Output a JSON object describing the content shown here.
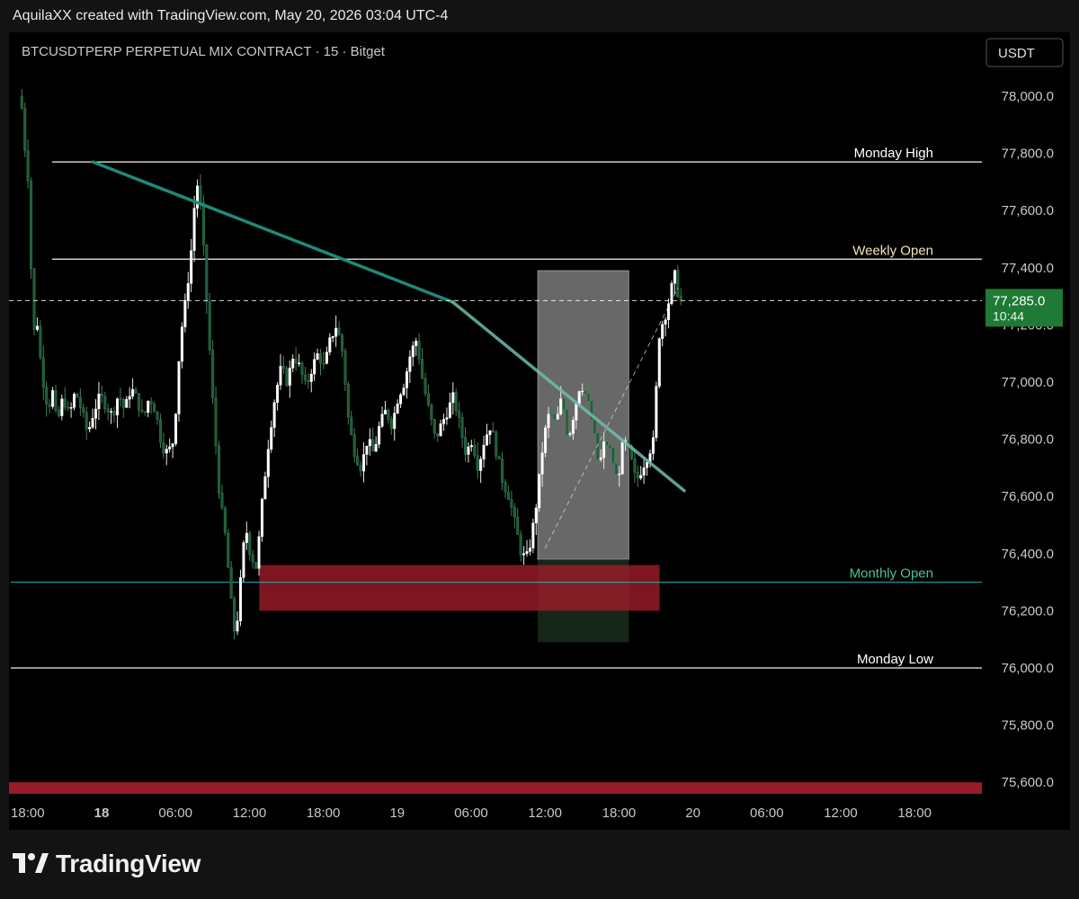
{
  "header": {
    "attribution": "AquilaXX created with TradingView.com, May 20, 2026 03:04 UTC-4"
  },
  "footer": {
    "brand": "TradingView"
  },
  "colors": {
    "background": "#000000",
    "candle_up": "#ffffff",
    "candle_down": "#1b5e3b",
    "trendline": "#1f8a78",
    "level_line": "#ffffff",
    "monthly_open_line": "#26a69a",
    "red_zone": "#9a1c2a",
    "current_price_bg": "#1e7a35"
  },
  "chart_data": {
    "type": "candlestick",
    "title": "BTCUSDTPERP PERPETUAL MIX CONTRACT · 15 · Bitget",
    "currency_button": "USDT",
    "ylim": [
      75600,
      78100
    ],
    "y_ticks": [
      "78,000.0",
      "77,800.0",
      "77,600.0",
      "77,400.0",
      "77,200.0",
      "77,000.0",
      "76,800.0",
      "76,600.0",
      "76,400.0",
      "76,200.0",
      "76,000.0",
      "75,800.0",
      "75,600.0"
    ],
    "x_ticks": [
      "18:00",
      "18",
      "06:00",
      "12:00",
      "18:00",
      "19",
      "06:00",
      "12:00",
      "18:00",
      "20",
      "06:00",
      "12:00",
      "18:00"
    ],
    "x_tick_hours": [
      -6,
      0,
      6,
      12,
      18,
      24,
      30,
      36,
      42,
      48,
      54,
      60,
      66
    ],
    "bold_ticks": [
      "18"
    ],
    "levels": [
      {
        "label": "Monday High",
        "price": 77770
      },
      {
        "label": "Weekly Open",
        "price": 77430
      },
      {
        "label": "Monthly Open",
        "price": 76300
      },
      {
        "label": "Monday Low",
        "price": 76000
      }
    ],
    "current_price": {
      "value": 77285,
      "label": "77,285.0",
      "countdown": "10:44"
    },
    "trendline": {
      "start": [
        -0.7,
        77770
      ],
      "end": [
        28.5,
        77280
      ],
      "extend_to": [
        47.3,
        76620
      ]
    },
    "demand_zone": {
      "x_from": 12.8,
      "x_to": 45.3,
      "y_from": 76200,
      "y_to": 76360
    },
    "position_box": {
      "x_from": 35.4,
      "x_to": 42.8,
      "entry": 76380,
      "target": 77390,
      "stop": 76090
    },
    "bottom_band": {
      "y_from": 75560,
      "y_to": 75600
    },
    "price_path": [
      [
        -6.6,
        78000
      ],
      [
        -6.3,
        77950
      ],
      [
        -6.1,
        77820
      ],
      [
        -5.8,
        77700
      ],
      [
        -5.6,
        77400
      ],
      [
        -5.4,
        77150
      ],
      [
        -5.2,
        77260
      ],
      [
        -4.9,
        77100
      ],
      [
        -4.6,
        77000
      ],
      [
        -4.2,
        76900
      ],
      [
        -3.9,
        76980
      ],
      [
        -3.5,
        76850
      ],
      [
        -3.0,
        76950
      ],
      [
        -2.5,
        76880
      ],
      [
        -2.0,
        76970
      ],
      [
        -1.5,
        76900
      ],
      [
        -1.0,
        76820
      ],
      [
        -0.5,
        76900
      ],
      [
        0.0,
        76950
      ],
      [
        0.5,
        76920
      ],
      [
        1.0,
        76880
      ],
      [
        1.5,
        76960
      ],
      [
        2.0,
        76900
      ],
      [
        2.5,
        76980
      ],
      [
        3.0,
        76940
      ],
      [
        3.5,
        76870
      ],
      [
        4.0,
        76950
      ],
      [
        4.5,
        76900
      ],
      [
        5.0,
        76780
      ],
      [
        5.5,
        76750
      ],
      [
        6.0,
        76800
      ],
      [
        6.5,
        77150
      ],
      [
        7.0,
        77300
      ],
      [
        7.5,
        77500
      ],
      [
        7.8,
        77720
      ],
      [
        8.2,
        77600
      ],
      [
        8.7,
        77250
      ],
      [
        9.2,
        76900
      ],
      [
        9.7,
        76600
      ],
      [
        10.2,
        76450
      ],
      [
        10.7,
        76200
      ],
      [
        11.0,
        76100
      ],
      [
        11.4,
        76300
      ],
      [
        11.8,
        76500
      ],
      [
        12.2,
        76400
      ],
      [
        12.7,
        76350
      ],
      [
        13.2,
        76600
      ],
      [
        13.7,
        76800
      ],
      [
        14.2,
        76950
      ],
      [
        14.7,
        77050
      ],
      [
        15.2,
        77000
      ],
      [
        15.7,
        77100
      ],
      [
        16.2,
        77050
      ],
      [
        16.7,
        76980
      ],
      [
        17.2,
        77050
      ],
      [
        17.7,
        77100
      ],
      [
        18.2,
        77050
      ],
      [
        18.7,
        77150
      ],
      [
        19.2,
        77200
      ],
      [
        19.7,
        77100
      ],
      [
        20.2,
        76850
      ],
      [
        20.7,
        76750
      ],
      [
        21.2,
        76700
      ],
      [
        21.7,
        76800
      ],
      [
        22.2,
        76750
      ],
      [
        22.7,
        76850
      ],
      [
        23.2,
        76900
      ],
      [
        23.7,
        76850
      ],
      [
        24.2,
        76950
      ],
      [
        24.7,
        77000
      ],
      [
        25.2,
        77100
      ],
      [
        25.7,
        77150
      ],
      [
        26.2,
        77000
      ],
      [
        26.7,
        76900
      ],
      [
        27.2,
        76800
      ],
      [
        27.7,
        76850
      ],
      [
        28.2,
        76900
      ],
      [
        28.7,
        76950
      ],
      [
        29.2,
        76850
      ],
      [
        29.7,
        76750
      ],
      [
        30.2,
        76800
      ],
      [
        30.7,
        76700
      ],
      [
        31.2,
        76800
      ],
      [
        31.7,
        76850
      ],
      [
        32.2,
        76750
      ],
      [
        32.7,
        76650
      ],
      [
        33.2,
        76600
      ],
      [
        33.7,
        76500
      ],
      [
        34.2,
        76400
      ],
      [
        34.6,
        76380
      ],
      [
        35.0,
        76450
      ],
      [
        35.5,
        76600
      ],
      [
        36.0,
        76800
      ],
      [
        36.5,
        76900
      ],
      [
        37.0,
        76850
      ],
      [
        37.5,
        76950
      ],
      [
        38.0,
        76800
      ],
      [
        38.5,
        76900
      ],
      [
        39.0,
        77000
      ],
      [
        39.5,
        76950
      ],
      [
        40.0,
        76850
      ],
      [
        40.5,
        76700
      ],
      [
        41.0,
        76800
      ],
      [
        41.5,
        76750
      ],
      [
        42.0,
        76650
      ],
      [
        42.5,
        76800
      ],
      [
        43.0,
        76750
      ],
      [
        43.5,
        76650
      ],
      [
        44.0,
        76700
      ],
      [
        44.5,
        76750
      ],
      [
        45.0,
        76800
      ],
      [
        45.3,
        77150
      ],
      [
        45.6,
        77200
      ],
      [
        46.0,
        77250
      ],
      [
        46.4,
        77330
      ],
      [
        46.7,
        77380
      ],
      [
        47.0,
        77285
      ]
    ]
  }
}
